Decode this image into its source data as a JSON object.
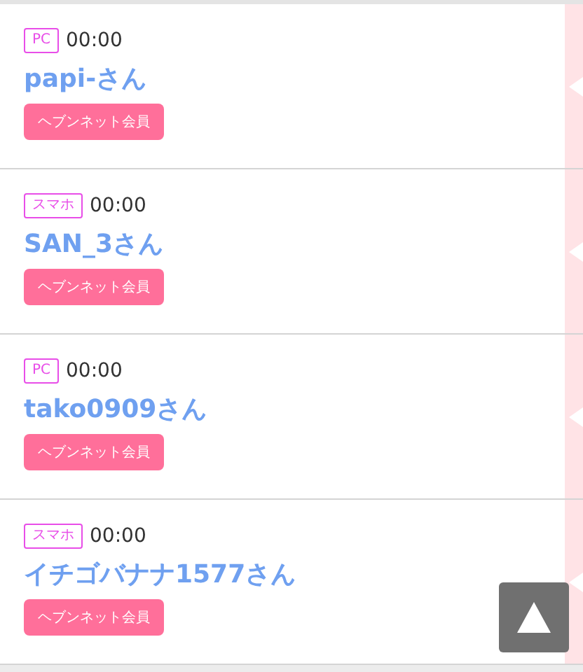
{
  "members": [
    {
      "device": "PC",
      "time": "00:00",
      "name": "papi-さん",
      "badge": "ヘブンネット会員"
    },
    {
      "device": "スマホ",
      "time": "00:00",
      "name": "SAN_3さん",
      "badge": "ヘブンネット会員"
    },
    {
      "device": "PC",
      "time": "00:00",
      "name": "tako0909さん",
      "badge": "ヘブンネット会員"
    },
    {
      "device": "スマホ",
      "time": "00:00",
      "name": "イチゴバナナ1577さん",
      "badge": "ヘブンネット会員"
    }
  ]
}
